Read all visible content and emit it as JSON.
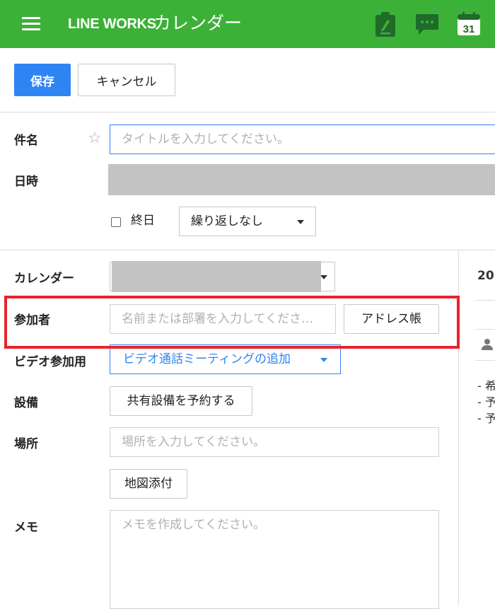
{
  "header": {
    "logo": "LINE WORKS",
    "app_title": "カレンダー",
    "icons": [
      "menu-icon",
      "notes-icon",
      "chat-icon",
      "calendar-icon"
    ],
    "calendar_day": "31",
    "color": "#3cb137"
  },
  "toolbar": {
    "save_label": "保存",
    "cancel_label": "キャンセル",
    "save_color": "#2f84f3"
  },
  "form": {
    "subject_label": "件名",
    "subject_placeholder": "タイトルを入力してください。",
    "datetime_label": "日時",
    "allday_label": "終日",
    "repeat_value": "繰り返しなし",
    "calendar_label": "カレンダー",
    "attendees_label": "参加者",
    "attendees_placeholder": "名前または部署を入力してくださ…",
    "address_book_label": "アドレス帳",
    "video_label": "ビデオ参加用",
    "video_value": "ビデオ通話ミーティングの追加",
    "equipment_label": "設備",
    "equipment_button": "共有設備を予約する",
    "location_label": "場所",
    "location_placeholder": "場所を入力してください。",
    "map_button": "地図添付",
    "memo_label": "メモ",
    "memo_placeholder": "メモを作成してください。"
  },
  "side_panel": {
    "year_fragment": "20",
    "lines": [
      "- 希",
      "- 予",
      "- 予"
    ]
  },
  "highlight_color": "#e8232a"
}
